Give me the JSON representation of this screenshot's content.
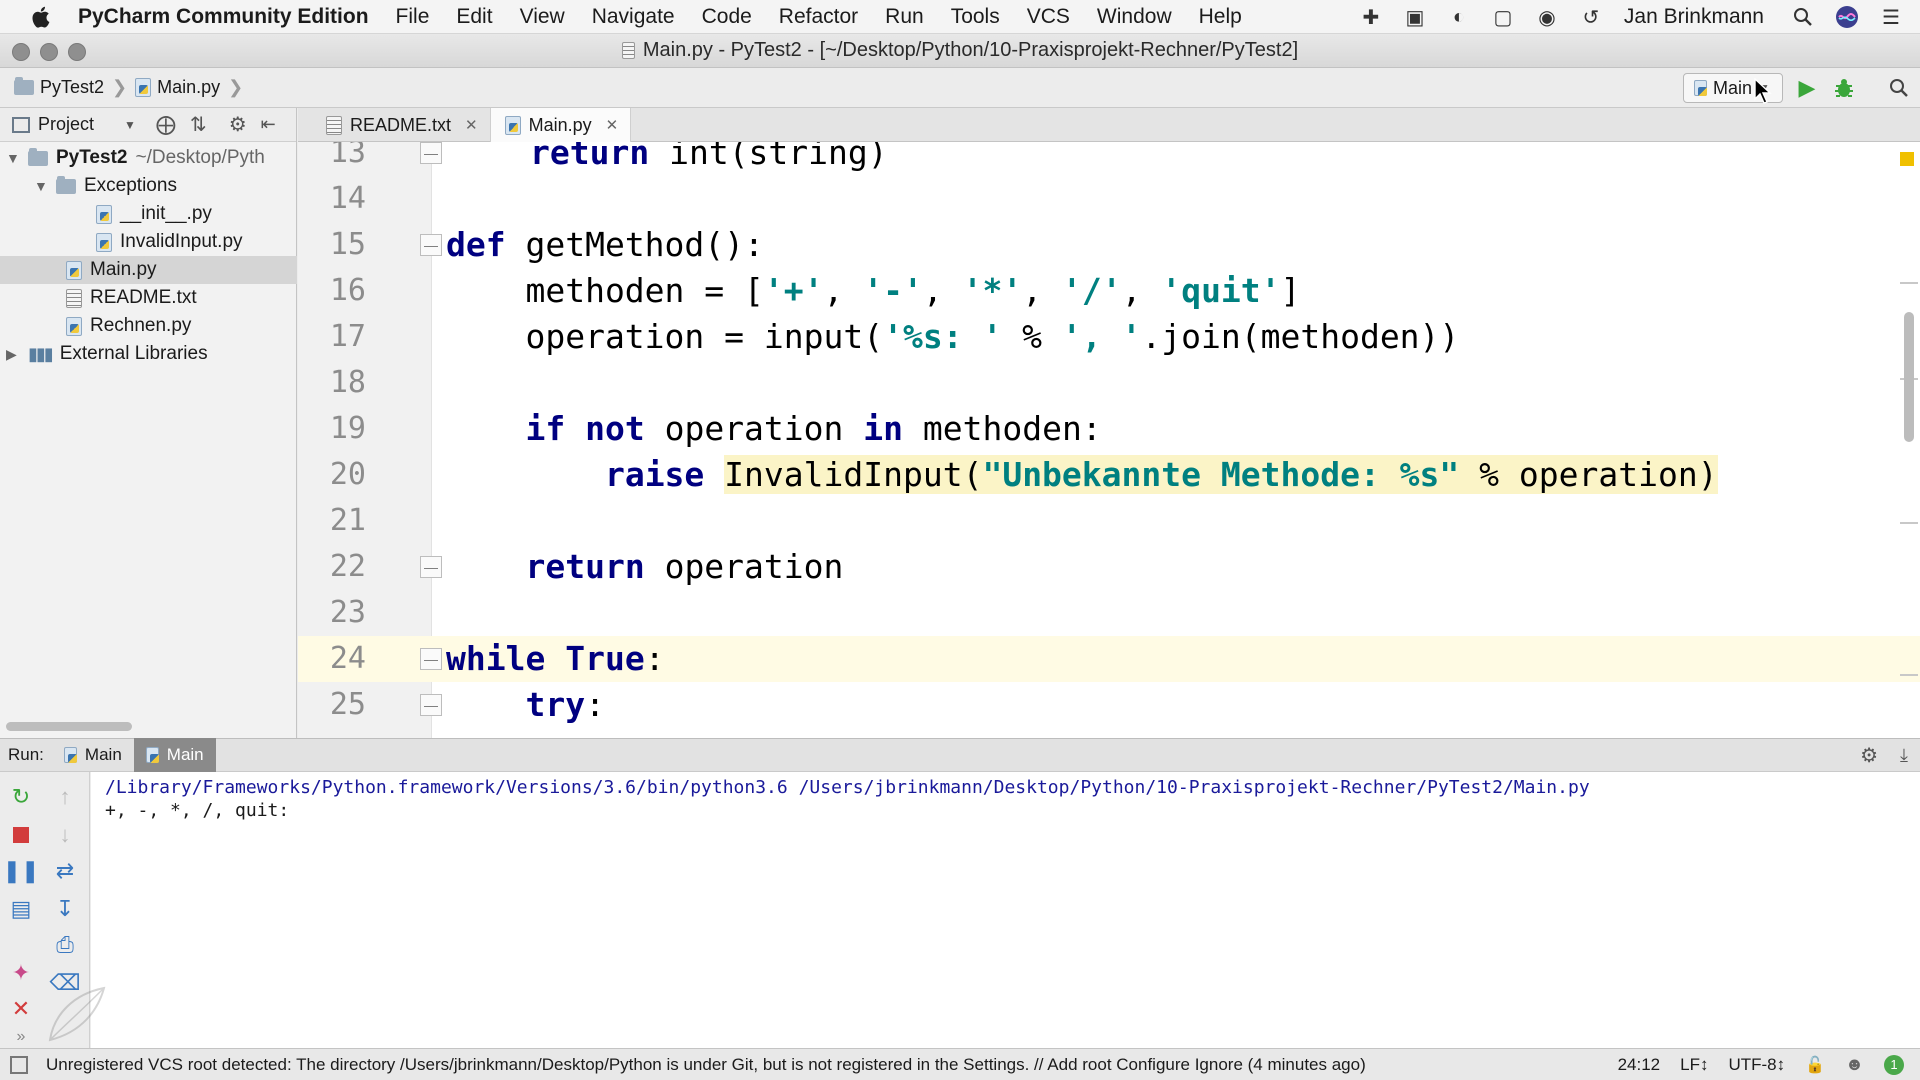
{
  "menubar": {
    "app_name": "PyCharm Community Edition",
    "menus": [
      "File",
      "Edit",
      "View",
      "Navigate",
      "Code",
      "Refactor",
      "Run",
      "Tools",
      "VCS",
      "Window",
      "Help"
    ],
    "user": "Jan Brinkmann"
  },
  "window": {
    "title": "Main.py - PyTest2 - [~/Desktop/Python/10-Praxisprojekt-Rechner/PyTest2]"
  },
  "navbar": {
    "breadcrumb_project": "PyTest2",
    "breadcrumb_file": "Main.py",
    "run_config": "Main"
  },
  "project_panel": {
    "label": "Project",
    "tree": {
      "root_name": "PyTest2",
      "root_path": "~/Desktop/Pyth",
      "exceptions": "Exceptions",
      "init_file": "__init__.py",
      "invalid_file": "InvalidInput.py",
      "main_file": "Main.py",
      "readme_file": "README.txt",
      "rechnen_file": "Rechnen.py",
      "external": "External Libraries"
    }
  },
  "tabs": {
    "readme": "README.txt",
    "main": "Main.py"
  },
  "editor": {
    "lines": [
      "13",
      "14",
      "15",
      "16",
      "17",
      "18",
      "19",
      "20",
      "21",
      "22",
      "23",
      "24",
      "25"
    ],
    "code": {
      "l13_kw": "return",
      "l13_rest": " int(string)",
      "l15_kw": "def",
      "l15_rest": " getMethod():",
      "l16_a": "    methoden = [",
      "l16_s1": "'+'",
      "l16_c1": ", ",
      "l16_s2": "'-'",
      "l16_c2": ", ",
      "l16_s3": "'*'",
      "l16_c3": ", ",
      "l16_s4": "'/'",
      "l16_c4": ", ",
      "l16_s5": "'quit'",
      "l16_end": "]",
      "l17_a": "    operation = input(",
      "l17_s1": "'%s: '",
      "l17_b": " % ",
      "l17_s2": "', '",
      "l17_c": ".join(methoden))",
      "l19_indent": "    ",
      "l19_kw1": "if",
      "l19_sp": " ",
      "l19_kw2": "not",
      "l19_b": " operation ",
      "l19_kw3": "in",
      "l19_c": " methoden:",
      "l20_indent": "        ",
      "l20_kw": "raise",
      "l20_sp": " ",
      "l20_call": "InvalidInput(",
      "l20_str": "\"Unbekannte Methode: %s\"",
      "l20_rest": " % operation)",
      "l22_indent": "    ",
      "l22_kw": "return",
      "l22_rest": " operation",
      "l24_kw1": "while",
      "l24_sp": " ",
      "l24_kw2": "True",
      "l24_colon": ":",
      "l25_indent": "    ",
      "l25_kw": "try",
      "l25_colon": ":"
    }
  },
  "run_panel": {
    "label": "Run:",
    "tab1": "Main",
    "tab2": "Main",
    "console_line1": "/Library/Frameworks/Python.framework/Versions/3.6/bin/python3.6 /Users/jbrinkmann/Desktop/Python/10-Praxisprojekt-Rechner/PyTest2/Main.py",
    "console_line2": "+, -, *, /, quit:"
  },
  "statusbar": {
    "message": "Unregistered VCS root detected: The directory /Users/jbrinkmann/Desktop/Python is under Git, but is not registered in the Settings. // Add root  Configure  Ignore (4 minutes ago)",
    "position": "24:12",
    "line_sep": "LF↕",
    "encoding": "UTF-8↕",
    "badge": "1"
  },
  "colors": {
    "keyword": "#000080",
    "string": "#008080",
    "current_line": "#fffbe4",
    "highlight": "#fbf4c7"
  }
}
